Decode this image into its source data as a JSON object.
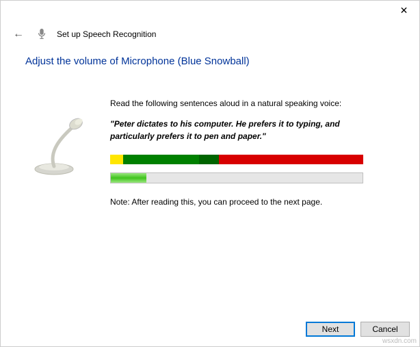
{
  "titlebar": {
    "close_glyph": "✕"
  },
  "header": {
    "back_glyph": "←",
    "wizard_title": "Set up Speech Recognition"
  },
  "page": {
    "heading": "Adjust the volume of Microphone (Blue Snowball)",
    "instruction": "Read the following sentences aloud in a natural speaking voice:",
    "sample": "\"Peter dictates to his computer. He prefers it to typing, and particularly prefers it to pen and paper.\"",
    "note": "Note: After reading this, you can proceed to the next page."
  },
  "volume_scale": {
    "segments": [
      {
        "name": "yellow",
        "color": "#ffe600",
        "width_pct": 5
      },
      {
        "name": "green",
        "color": "#008000",
        "width_pct": 30
      },
      {
        "name": "dark-green",
        "color": "#006400",
        "width_pct": 8
      },
      {
        "name": "red",
        "color": "#d80000",
        "width_pct": 57
      }
    ]
  },
  "input_level": {
    "fill_pct": 14
  },
  "buttons": {
    "next": "Next",
    "cancel": "Cancel"
  },
  "watermark": "wsxdn.com"
}
